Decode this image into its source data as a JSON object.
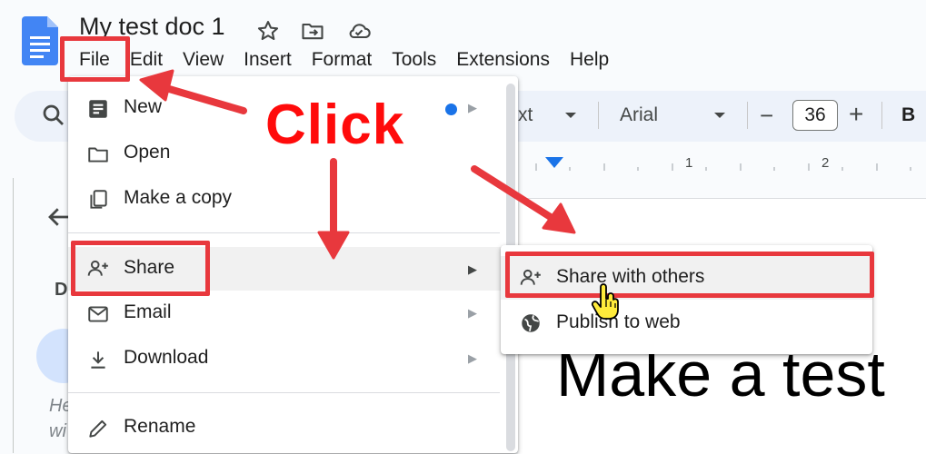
{
  "header": {
    "doc_title": "My test doc 1",
    "icons": [
      "docs-logo-icon",
      "star-icon",
      "move-folder-icon",
      "cloud-saved-icon"
    ]
  },
  "menubar": {
    "items": [
      "File",
      "Edit",
      "View",
      "Insert",
      "Format",
      "Tools",
      "Extensions",
      "Help"
    ]
  },
  "toolbar": {
    "style_partial": "xt",
    "font": "Arial",
    "minus": "−",
    "font_size": "36",
    "plus": "+",
    "bold": "B"
  },
  "ruler": {
    "marks": [
      "1",
      "2"
    ]
  },
  "outline": {
    "heading_partial": "D",
    "hint_line1": "He",
    "hint_line2": "wi"
  },
  "file_menu": {
    "items": [
      {
        "label": "New",
        "icon": "new-doc-icon",
        "has_submenu": true,
        "badge": "blue-dot"
      },
      {
        "label": "Open",
        "icon": "folder-icon",
        "has_submenu": false
      },
      {
        "label": "Make a copy",
        "icon": "copy-icon",
        "has_submenu": false
      },
      {
        "label": "Share",
        "icon": "person-add-icon",
        "has_submenu": true,
        "highlighted": true
      },
      {
        "label": "Email",
        "icon": "email-icon",
        "has_submenu": true
      },
      {
        "label": "Download",
        "icon": "download-icon",
        "has_submenu": true
      },
      {
        "label": "Rename",
        "icon": "pencil-icon",
        "has_submenu": false
      }
    ]
  },
  "share_submenu": {
    "items": [
      {
        "label": "Share with others",
        "icon": "person-add-icon",
        "highlighted": true
      },
      {
        "label": "Publish to web",
        "icon": "globe-icon"
      }
    ]
  },
  "document": {
    "body_text": "Make a test"
  },
  "annotation": {
    "click_label": "Click",
    "color": "#e8383d"
  },
  "colors": {
    "docs_blue": "#4285f4",
    "accent_blue": "#1a73e8",
    "annotation_red": "#e8383d"
  }
}
